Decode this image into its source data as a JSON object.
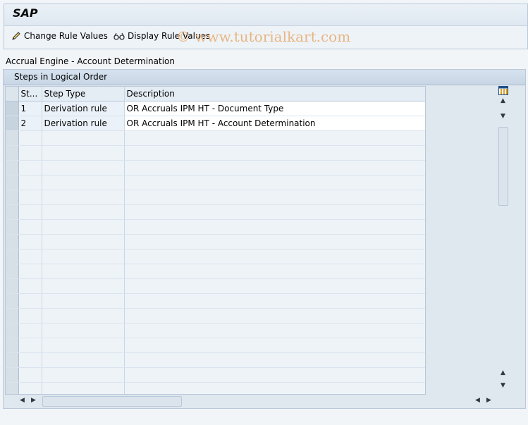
{
  "app": {
    "title": "SAP"
  },
  "toolbar": {
    "change_label": "Change Rule Values",
    "display_label": "Display Rule Values",
    "watermark": "© www.tutorialkart.com"
  },
  "section": {
    "title": "Accrual Engine - Account Determination"
  },
  "panel": {
    "title": "Steps in Logical Order"
  },
  "table": {
    "columns": [
      "St...",
      "Step Type",
      "Description"
    ],
    "rows": [
      {
        "step": "1",
        "type": "Derivation rule",
        "description": "OR Accruals IPM HT - Document Type"
      },
      {
        "step": "2",
        "type": "Derivation rule",
        "description": "OR Accruals IPM HT - Account Determination"
      }
    ]
  },
  "icons": {
    "change": "pencil-icon",
    "display": "glasses-icon",
    "config": "table-config-icon"
  }
}
